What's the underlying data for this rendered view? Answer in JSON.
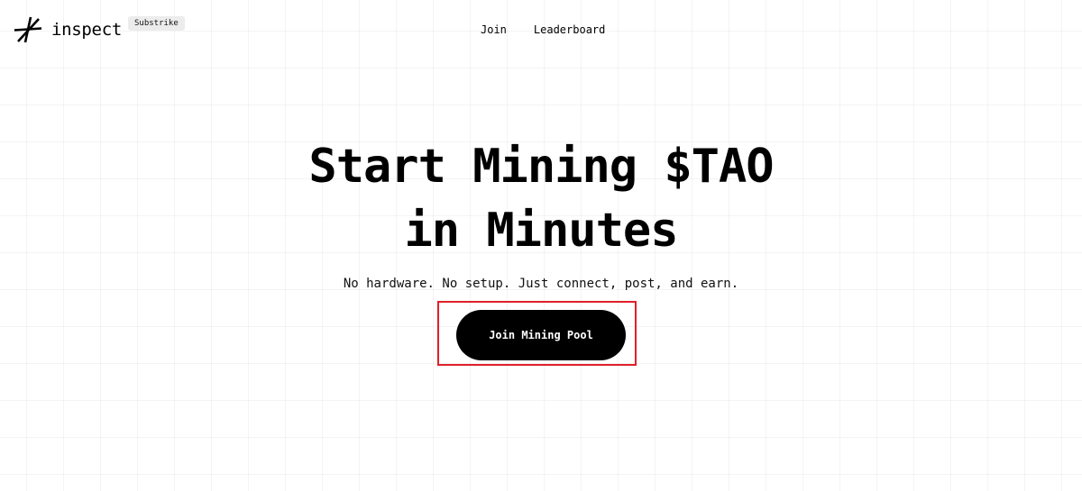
{
  "header": {
    "logo_text": "inspect",
    "badge": "Substrike",
    "nav": [
      {
        "label": "Join"
      },
      {
        "label": "Leaderboard"
      }
    ]
  },
  "hero": {
    "title_line1": "Start Mining $TAO",
    "title_line2": "in Minutes",
    "subtitle": "No hardware. No setup. Just connect, post, and earn.",
    "cta_label": "Join Mining Pool"
  },
  "icons": {
    "logo": "asterisk-logo-icon"
  },
  "colors": {
    "background": "#ffffff",
    "text": "#000000",
    "button_bg": "#000000",
    "button_text": "#ffffff",
    "highlight_border": "#e0202a",
    "badge_bg": "#ececec"
  }
}
